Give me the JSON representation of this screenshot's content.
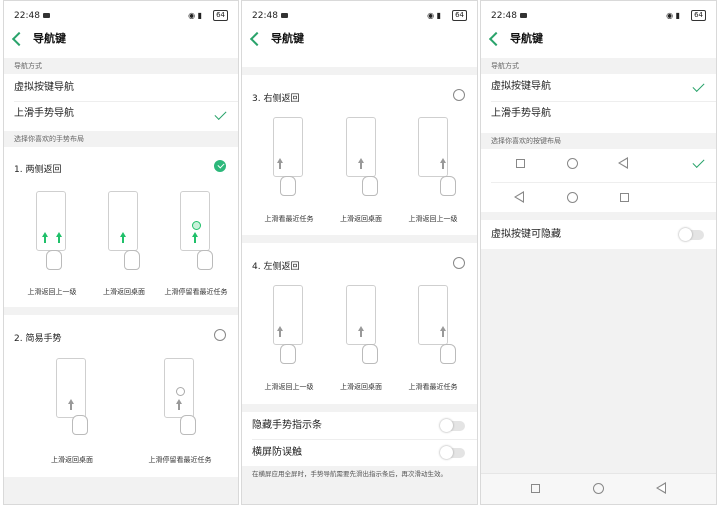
{
  "status": {
    "time": "22:48",
    "signal": "◉ ▮",
    "battery": "64"
  },
  "title": "导航键",
  "panel1": {
    "section_method": "导航方式",
    "opt_virtual": "虚拟按键导航",
    "opt_gesture": "上滑手势导航",
    "section_layout": "选择你喜欢的手势布局",
    "g1_title": "1. 两侧返回",
    "g1_caps": [
      "上滑返回上一级",
      "上滑返回桌面",
      "上滑停留看最近任务"
    ],
    "g2_title": "2. 简易手势",
    "g2_caps": [
      "上滑返回桌面",
      "上滑停留看最近任务"
    ]
  },
  "panel2": {
    "g3_title": "3. 右侧返回",
    "g3_caps": [
      "上滑看最近任务",
      "上滑返回桌面",
      "上滑返回上一级"
    ],
    "g4_title": "4. 左侧返回",
    "g4_caps": [
      "上滑返回上一级",
      "上滑返回桌面",
      "上滑看最近任务"
    ],
    "hide_bar": "隐藏手势指示条",
    "landscape": "横屏防误触",
    "landscape_desc": "在横屏应用全屏时，手势导航需要先滑出指示条后，再次滑动生效。"
  },
  "panel3": {
    "section_method": "导航方式",
    "opt_virtual": "虚拟按键导航",
    "opt_gesture": "上滑手势导航",
    "section_layout": "选择你喜欢的按键布局",
    "hideable": "虚拟按键可隐藏"
  },
  "colors": {
    "accent": "#2aa36b"
  }
}
